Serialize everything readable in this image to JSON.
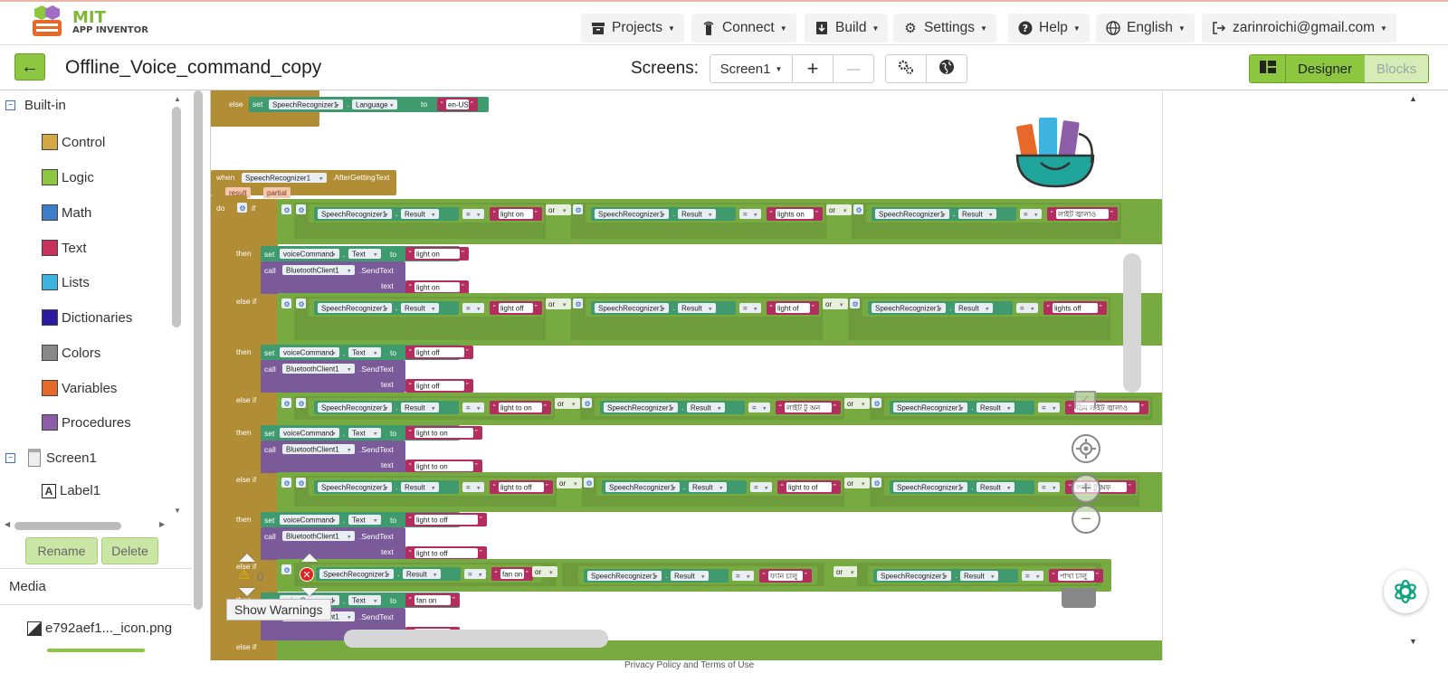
{
  "app": {
    "logo_line1": "MIT",
    "logo_line2": "APP INVENTOR"
  },
  "nav": {
    "projects": "Projects",
    "connect": "Connect",
    "build": "Build",
    "settings": "Settings",
    "help": "Help",
    "language": "English",
    "account": "zarinroichi@gmail.com"
  },
  "toolbar": {
    "project_title": "Offline_Voice_command_copy",
    "screens_label": "Screens:",
    "screen_select": "Screen1",
    "add_screen": "+",
    "remove_screen": "—",
    "designer": "Designer",
    "blocks": "Blocks"
  },
  "left": {
    "builtin": "Built-in",
    "items": [
      {
        "label": "Control",
        "color": "#d4a843"
      },
      {
        "label": "Logic",
        "color": "#8dc63f"
      },
      {
        "label": "Math",
        "color": "#3b7ec7"
      },
      {
        "label": "Text",
        "color": "#c8325b"
      },
      {
        "label": "Lists",
        "color": "#3cb4df"
      },
      {
        "label": "Dictionaries",
        "color": "#2a1aa0"
      },
      {
        "label": "Colors",
        "color": "#888888"
      },
      {
        "label": "Variables",
        "color": "#e6692a"
      },
      {
        "label": "Procedures",
        "color": "#8c5ea8"
      }
    ],
    "screen1": "Screen1",
    "label1": "Label1",
    "rename": "Rename",
    "delete": "Delete",
    "media": "Media",
    "media_file": "e792aef1..._icon.png"
  },
  "blocks": {
    "else": "else",
    "set": "set",
    "to": "to",
    "speech": "SpeechRecognizer1",
    "language": "Language",
    "en_us": "en-US",
    "when": "when",
    "after_getting_text": ".AfterGettingText",
    "result": "result",
    "partial": "partial",
    "do": "do",
    "if": "if",
    "then": "then",
    "else_if": "else if",
    "or": "or",
    "result_prop": "Result",
    "eq": "=",
    "voice_command": "voiceCommand",
    "text_prop": "Text",
    "call": "call",
    "bt": "BluetoothClient1",
    "send_text": ".SendText",
    "text_arg": "text",
    "s_light_on": "light on",
    "s_lights_on": "lights on",
    "s_bn_light_on": "লাইট জ্বালাও",
    "s_light_off": "light off",
    "s_light_of": "light of",
    "s_lights_off": "lights off",
    "s_light_to_on": "light to on",
    "s_bn_light_tu_on": "লাইট টু অন",
    "s_bn_dim_light": "ডিম লাইট জ্বালাও",
    "s_light_to_off": "light to off",
    "s_light_to_of": "light to of",
    "s_bn_light_tu_off": "লাইট টু অফ",
    "s_fan_on": "fan on",
    "s_bn_fan_on": "ফ্যান চালু",
    "s_bn_pakha_on": "পাখা চালু"
  },
  "warnings": {
    "count": "0",
    "show": "Show Warnings"
  },
  "footer": "Privacy Policy and Terms of Use"
}
